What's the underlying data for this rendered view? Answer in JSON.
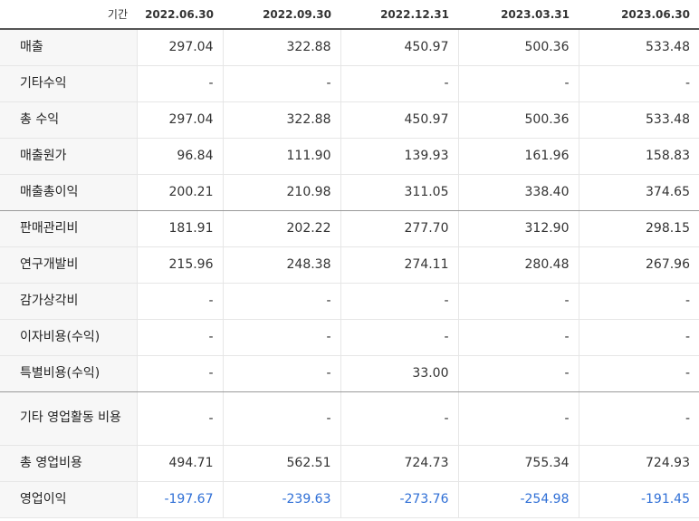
{
  "header": {
    "label": "기간",
    "periods": [
      "2022.06.30",
      "2022.09.30",
      "2022.12.31",
      "2023.03.31",
      "2023.06.30"
    ]
  },
  "colors": {
    "negative": "#2f6fd6",
    "label_bg": "#f7f7f7"
  },
  "rows": [
    {
      "label": "매출",
      "values": [
        "297.04",
        "322.88",
        "450.97",
        "500.36",
        "533.48"
      ]
    },
    {
      "label": "기타수익",
      "values": [
        "-",
        "-",
        "-",
        "-",
        "-"
      ]
    },
    {
      "label": "총 수익",
      "values": [
        "297.04",
        "322.88",
        "450.97",
        "500.36",
        "533.48"
      ]
    },
    {
      "label": "매출원가",
      "values": [
        "96.84",
        "111.90",
        "139.93",
        "161.96",
        "158.83"
      ]
    },
    {
      "label": "매출총이익",
      "values": [
        "200.21",
        "210.98",
        "311.05",
        "338.40",
        "374.65"
      ]
    },
    {
      "label": "판매관리비",
      "values": [
        "181.91",
        "202.22",
        "277.70",
        "312.90",
        "298.15"
      ]
    },
    {
      "label": "연구개발비",
      "values": [
        "215.96",
        "248.38",
        "274.11",
        "280.48",
        "267.96"
      ]
    },
    {
      "label": "감가상각비",
      "values": [
        "-",
        "-",
        "-",
        "-",
        "-"
      ]
    },
    {
      "label": "이자비용(수익)",
      "values": [
        "-",
        "-",
        "-",
        "-",
        "-"
      ]
    },
    {
      "label": "특별비용(수익)",
      "values": [
        "-",
        "-",
        "33.00",
        "-",
        "-"
      ]
    },
    {
      "label": "기타 영업활동 비용",
      "values": [
        "-",
        "-",
        "-",
        "-",
        "-"
      ]
    },
    {
      "label": "총 영업비용",
      "values": [
        "494.71",
        "562.51",
        "724.73",
        "755.34",
        "724.93"
      ]
    },
    {
      "label": "영업이익",
      "values": [
        "-197.67",
        "-239.63",
        "-273.76",
        "-254.98",
        "-191.45"
      ]
    }
  ]
}
